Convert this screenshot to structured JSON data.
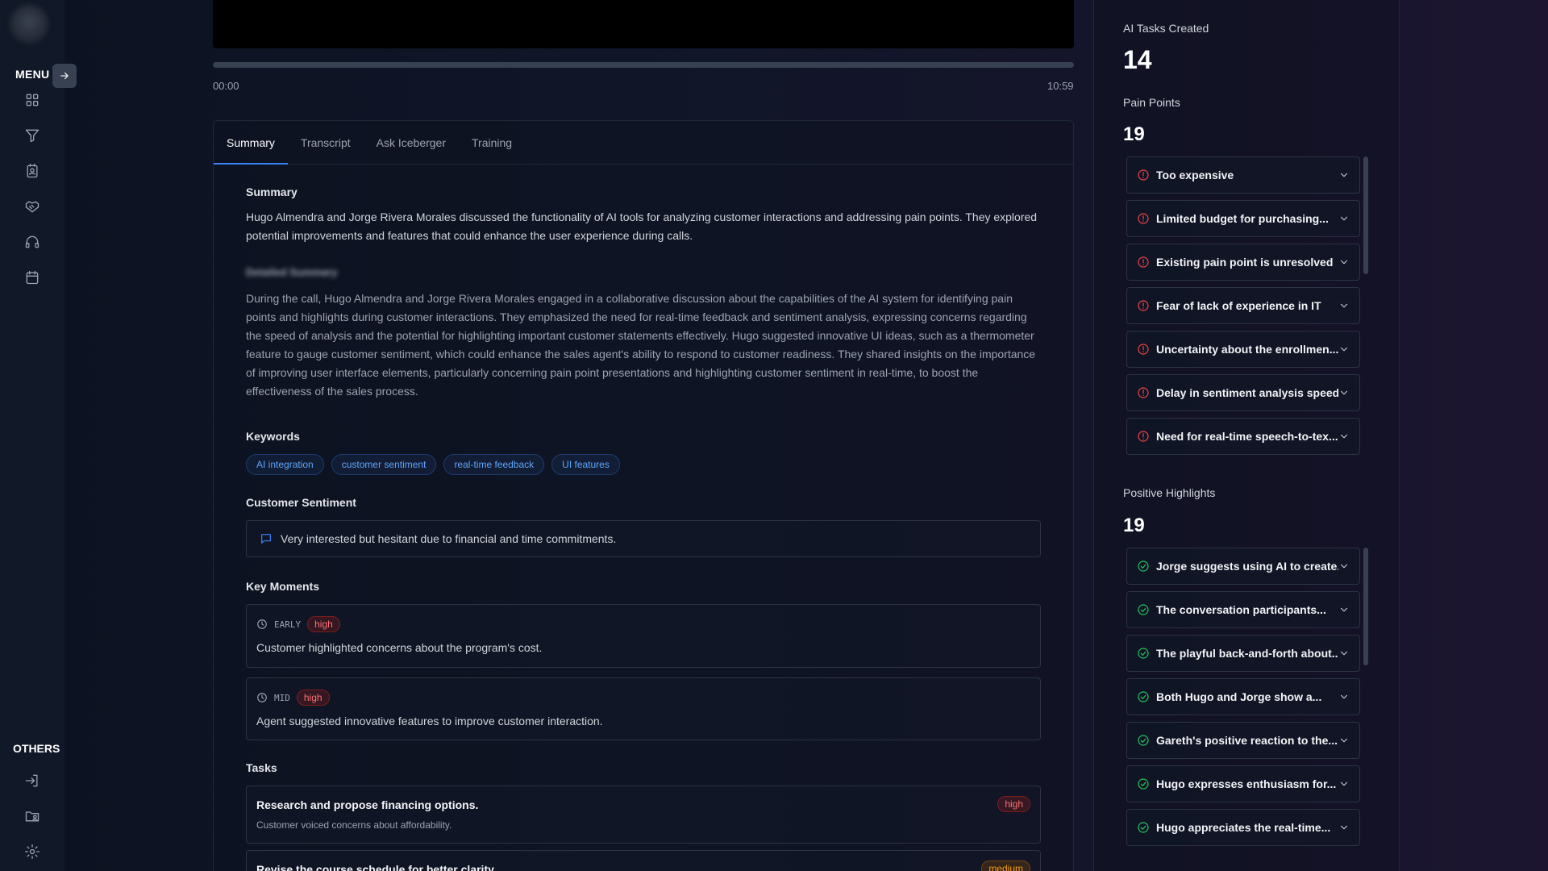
{
  "sidebar": {
    "menu_label": "MENU",
    "others_label": "OTHERS",
    "nav_icons": [
      "dashboard-icon",
      "filter-icon",
      "contacts-icon",
      "handshake-icon",
      "headset-icon",
      "calendar-icon"
    ],
    "other_icons": [
      "logout-icon",
      "folder-user-icon",
      "settings-icon"
    ]
  },
  "player": {
    "current_time": "00:00",
    "duration": "10:59"
  },
  "tabs": [
    "Summary",
    "Transcript",
    "Ask Iceberger",
    "Training"
  ],
  "summary": {
    "heading": "Summary",
    "text": "Hugo Almendra and Jorge Rivera Morales discussed the functionality of AI tools for analyzing customer interactions and addressing pain points. They explored potential improvements and features that could enhance the user experience during calls.",
    "detailed_heading": "Detailed Summary",
    "detailed_text": "During the call, Hugo Almendra and Jorge Rivera Morales engaged in a collaborative discussion about the capabilities of the AI system for identifying pain points and highlights during customer interactions. They emphasized the need for real-time feedback and sentiment analysis, expressing concerns regarding the speed of analysis and the potential for highlighting important customer statements effectively. Hugo suggested innovative UI ideas, such as a thermometer feature to gauge customer sentiment, which could enhance the sales agent's ability to respond to customer readiness. They shared insights on the importance of improving user interface elements, particularly concerning pain point presentations and highlighting customer sentiment in real-time, to boost the effectiveness of the sales process."
  },
  "keywords": {
    "heading": "Keywords",
    "items": [
      "AI integration",
      "customer sentiment",
      "real-time feedback",
      "UI features"
    ]
  },
  "sentiment": {
    "heading": "Customer Sentiment",
    "text": "Very interested but hesitant due to financial and time commitments."
  },
  "key_moments": {
    "heading": "Key Moments",
    "items": [
      {
        "phase": "EARLY",
        "level": "high",
        "text": "Customer highlighted concerns about the program's cost."
      },
      {
        "phase": "MID",
        "level": "high",
        "text": "Agent suggested innovative features to improve customer interaction."
      }
    ]
  },
  "tasks": {
    "heading": "Tasks",
    "items": [
      {
        "title": "Research and propose financing options.",
        "desc": "Customer voiced concerns about affordability.",
        "priority": "high"
      },
      {
        "title": "Revise the course schedule for better clarity.",
        "priority": "medium"
      }
    ]
  },
  "stats": {
    "ai_tasks_label": "AI Tasks Created",
    "ai_tasks_count": "14",
    "pain_points_label": "Pain Points",
    "pain_points_count": "19",
    "highlights_label": "Positive Highlights",
    "highlights_count": "19"
  },
  "pain_points": [
    "Too expensive",
    "Limited budget for purchasing...",
    "Existing pain point is unresolved",
    "Fear of lack of experience in IT",
    "Uncertainty about the enrollmen...",
    "Delay in sentiment analysis speed",
    "Need for real-time speech-to-tex..."
  ],
  "highlights": [
    "Jorge suggests using AI to create...",
    "The conversation participants...",
    "The playful back-and-forth about...",
    "Both Hugo and Jorge show a...",
    "Gareth's positive reaction to the...",
    "Hugo expresses enthusiasm for...",
    "Hugo appreciates the real-time..."
  ],
  "colors": {
    "accent": "#3b82f6",
    "pain": "#ef4444",
    "positive": "#22c55e"
  }
}
